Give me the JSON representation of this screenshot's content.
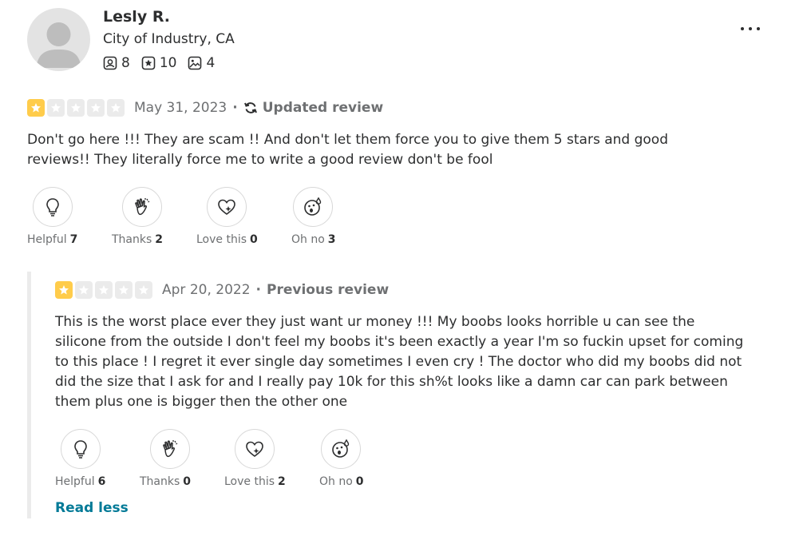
{
  "user": {
    "name": "Lesly R.",
    "location": "City of Industry, CA",
    "stats": [
      {
        "icon": "friends-icon",
        "value": "8"
      },
      {
        "icon": "reviews-star-icon",
        "value": "10"
      },
      {
        "icon": "photos-icon",
        "value": "4"
      }
    ]
  },
  "current_review": {
    "stars": 1,
    "date": "May 31, 2023",
    "tag": "Updated review",
    "text_lines": [
      "Don't go here !!! They are scam !! And don't let them force you to give them 5 stars and good",
      "reviews!! They literally force me to write a good review don't be fool"
    ],
    "reactions": [
      {
        "icon": "lightbulb-icon",
        "label": "Helpful",
        "count": "7"
      },
      {
        "icon": "clapping-hand-icon",
        "label": "Thanks",
        "count": "2"
      },
      {
        "icon": "heart-icon",
        "label": "Love this",
        "count": "0"
      },
      {
        "icon": "shocked-face-icon",
        "label": "Oh no",
        "count": "3"
      }
    ]
  },
  "previous_review": {
    "stars": 1,
    "date": "Apr 20, 2022",
    "tag": "Previous review",
    "text_lines": [
      "This is the worst place ever they just want ur money !!! My boobs looks horrible u can see the",
      "silicone from the outside I don't feel my boobs it's been exactly a year I'm so fuckin upset for coming",
      "to this place ! I regret it ever single day sometimes I even cry ! The doctor who did my boobs did not",
      "did the size that I ask for and I really pay 10k for this sh%t looks like a damn car can park between",
      "them plus one is bigger then the other one"
    ],
    "reactions": [
      {
        "icon": "lightbulb-icon",
        "label": "Helpful",
        "count": "6"
      },
      {
        "icon": "clapping-hand-icon",
        "label": "Thanks",
        "count": "0"
      },
      {
        "icon": "heart-icon",
        "label": "Love this",
        "count": "2"
      },
      {
        "icon": "shocked-face-icon",
        "label": "Oh no",
        "count": "0"
      }
    ],
    "read_less_label": "Read less"
  },
  "colors": {
    "star_on": "#ffcc4b",
    "star_off": "#ebebeb",
    "link": "#027a97"
  }
}
